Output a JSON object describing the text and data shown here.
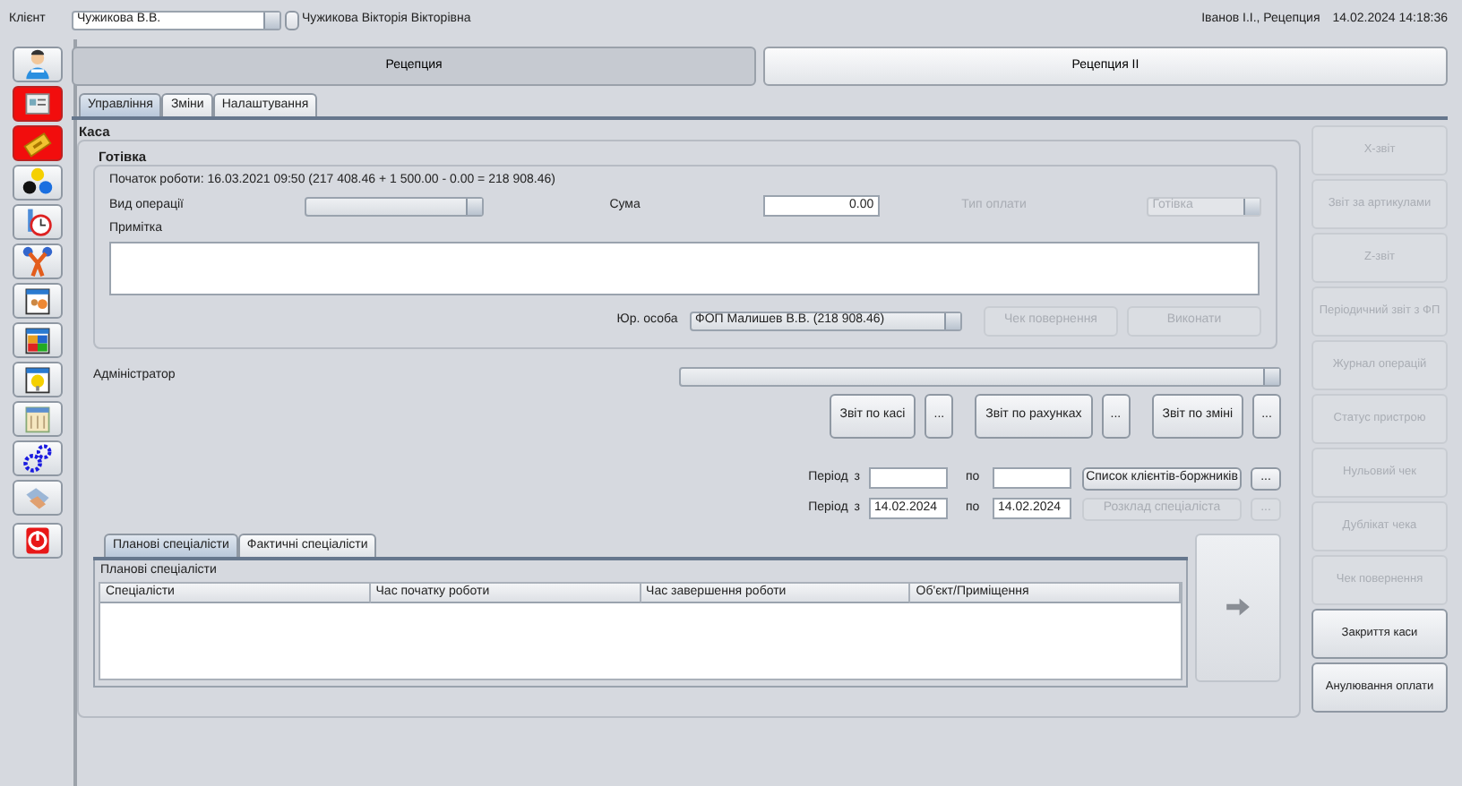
{
  "header": {
    "client_label": "Клієнт",
    "client_value": "Чужикова В.В.",
    "client_full_name": "Чужикова Вікторія Вікторівна",
    "user": "Іванов І.І., Рецепция",
    "datetime": "14.02.2024 14:18:36"
  },
  "sidebar": {
    "items": [
      {
        "highlighted": false
      },
      {
        "highlighted": true
      },
      {
        "highlighted": true
      },
      {
        "highlighted": false
      },
      {
        "highlighted": false
      },
      {
        "highlighted": false
      },
      {
        "highlighted": false
      },
      {
        "highlighted": false
      },
      {
        "highlighted": false
      },
      {
        "highlighted": false
      },
      {
        "highlighted": false
      },
      {
        "highlighted": false
      },
      {
        "highlighted": false
      }
    ]
  },
  "top_tabs": [
    {
      "label": "Рецепция",
      "selected": true
    },
    {
      "label": "Рецепция II",
      "selected": false
    }
  ],
  "sub_tabs": [
    {
      "label": "Управління",
      "selected": true
    },
    {
      "label": "Зміни",
      "selected": false
    },
    {
      "label": "Налаштування",
      "selected": false
    }
  ],
  "section_title": "Каса",
  "cash": {
    "title": "Готівка",
    "start_info": "Початок роботи: 16.03.2021 09:50 (217 408.46 + 1 500.00 - 0.00 = 218 908.46)",
    "operation_label": "Вид операції",
    "sum_label": "Сума",
    "sum_value": "0.00",
    "payment_type_label": "Тип оплати",
    "payment_type_value": "Готівка",
    "payment_type_disabled": true,
    "note_label": "Примітка",
    "legal_entity_label": "Юр. особа",
    "legal_entity_value": "ФОП Малишев В.В. (218 908.46)",
    "buttons": [
      {
        "label": "Чек повернення",
        "disabled": true
      },
      {
        "label": "Виконати",
        "disabled": true
      }
    ]
  },
  "admin_label": "Адміністратор",
  "report_buttons": [
    {
      "label": "Звіт по касі",
      "more": "..."
    },
    {
      "label": "Звіт по рахунках",
      "more": "..."
    },
    {
      "label": "Звіт по зміні",
      "more": "..."
    }
  ],
  "periods": [
    {
      "label": "Період",
      "from": "з",
      "to": "по",
      "button": "Список клієнтів-боржників",
      "more": "...",
      "disabled": false
    },
    {
      "label": "Період",
      "from": "з",
      "from_value": "14.02.2024",
      "to": "по",
      "to_value": "14.02.2024",
      "button": "Розклад спеціаліста",
      "more": "...",
      "disabled": true
    }
  ],
  "bottom_tabs": [
    {
      "label": "Планові спеціалісти",
      "selected": true
    },
    {
      "label": "Фактичні спеціалісти",
      "selected": false
    }
  ],
  "table": {
    "title": "Планові спеціалісти",
    "columns": [
      "Спеціалісти",
      "Час початку роботи",
      "Час завершення роботи",
      "Об'єкт/Приміщення"
    ]
  },
  "side_buttons": [
    {
      "label": "X-звіт",
      "disabled": true
    },
    {
      "label": "Звіт за артикулами",
      "disabled": true
    },
    {
      "label": "Z-звіт",
      "disabled": true
    },
    {
      "label": "Періодичний звіт з ФП",
      "disabled": true
    },
    {
      "label": "Журнал операцій",
      "disabled": true
    },
    {
      "label": "Статус пристрою",
      "disabled": true
    },
    {
      "label": "Нульовий чек",
      "disabled": true
    },
    {
      "label": "Дублікат чека",
      "disabled": true
    },
    {
      "label": "Чек повернення",
      "disabled": true
    },
    {
      "label": "Закриття каси",
      "disabled": false
    },
    {
      "label": "Анулювання оплати",
      "disabled": false
    }
  ]
}
